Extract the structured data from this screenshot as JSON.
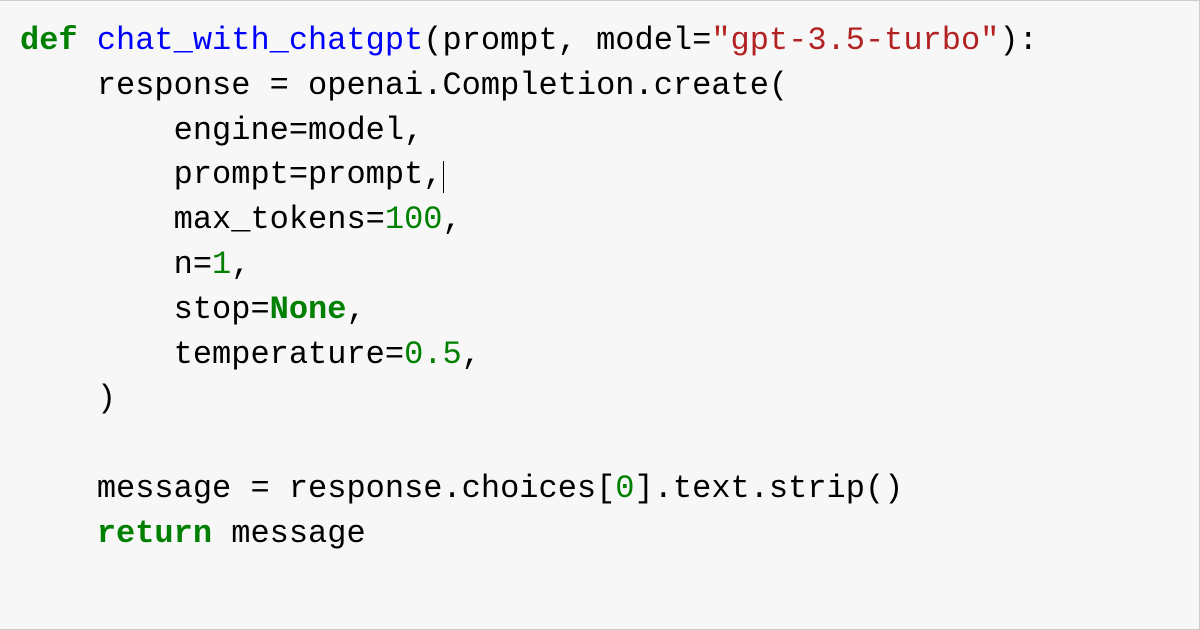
{
  "code": {
    "line1": {
      "kw_def": "def",
      "sp1": " ",
      "fn": "chat_with_chatgpt",
      "after_fn": "(prompt, model=",
      "str": "\"gpt-3.5-turbo\"",
      "tail": "):"
    },
    "line2": "    response = openai.Completion.create(",
    "line3": {
      "indent": "        engine=model",
      "comma": ","
    },
    "line4": {
      "indent": "        prompt=prompt",
      "comma": ","
    },
    "line5": {
      "pre": "        max_tokens=",
      "num": "100",
      "comma": ","
    },
    "line6": {
      "pre": "        n=",
      "num": "1",
      "comma": ","
    },
    "line7": {
      "pre": "        stop=",
      "none": "None",
      "comma": ","
    },
    "line8": {
      "pre": "        temperature=",
      "num": "0.5",
      "comma": ","
    },
    "line9": "    )",
    "line10": "",
    "line11": {
      "pre": "    message = response.choices[",
      "num": "0",
      "post": "].text.strip()"
    },
    "line12": {
      "indent": "    ",
      "kw_return": "return",
      "rest": " message"
    }
  }
}
